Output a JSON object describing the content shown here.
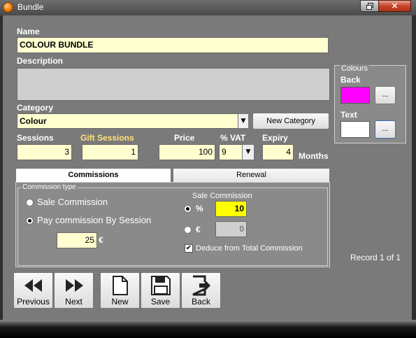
{
  "window": {
    "title": "Bundle",
    "close_glyph": "×"
  },
  "form": {
    "name_label": "Name",
    "name_value": "COLOUR BUNDLE",
    "description_label": "Description",
    "description_value": "",
    "category_label": "Category",
    "category_value": "Colour",
    "new_category_label": "New Category",
    "sessions_label": "Sessions",
    "sessions_value": "3",
    "gift_sessions_label": "Gift Sessions",
    "gift_sessions_value": "1",
    "price_label": "Price",
    "price_value": "100",
    "vat_label": "% VAT",
    "vat_value": "9",
    "expiry_label": "Expiry",
    "expiry_value": "4",
    "months_label": "Months"
  },
  "colours": {
    "group_label": "Colours",
    "back_label": "Back",
    "back_color": "#ff00ff",
    "text_label": "Text",
    "text_color": "#ffffff",
    "picker_label": "..."
  },
  "tabs": [
    {
      "label": "Commissions",
      "active": true
    },
    {
      "label": "Renewal",
      "active": false
    }
  ],
  "commissions": {
    "type_label": "Commission type",
    "option_sale": "Sale Commission",
    "option_session": "Pay commission By Session",
    "selected": "session",
    "session_value": "25",
    "currency_symbol": "€",
    "sale_commission_label": "Sale Commission",
    "percent_symbol": "%",
    "percent_value": "10",
    "euro_symbol": "€",
    "euro_value": "0",
    "deduce_label": "Deduce from Total Commission",
    "deduce_checked": true
  },
  "record_status": "Record 1 of 1",
  "nav_buttons": [
    {
      "label": "Previous",
      "icon": "rewind-icon"
    },
    {
      "label": "Next",
      "icon": "fast-forward-icon"
    },
    {
      "label": "New",
      "icon": "new-document-icon"
    },
    {
      "label": "Save",
      "icon": "floppy-disk-icon"
    },
    {
      "label": "Back",
      "icon": "exit-icon"
    }
  ]
}
